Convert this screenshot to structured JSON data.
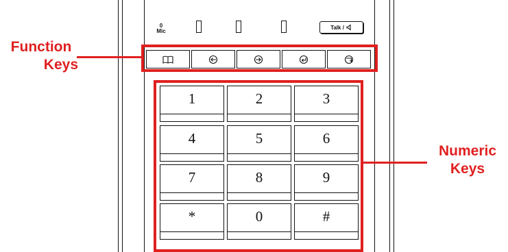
{
  "device": {
    "mic_label_top": "0",
    "mic_label_bottom": "Mic",
    "talk_button_label": "Talk /",
    "function_keys": [
      {
        "icon": "phonebook-icon"
      },
      {
        "icon": "arrow-left-icon"
      },
      {
        "icon": "arrow-right-icon"
      },
      {
        "icon": "enter-icon"
      },
      {
        "icon": "hangup-icon"
      }
    ],
    "numeric_keys": [
      [
        "1",
        "2",
        "3"
      ],
      [
        "4",
        "5",
        "6"
      ],
      [
        "7",
        "8",
        "9"
      ],
      [
        "*",
        "0",
        "#"
      ]
    ]
  },
  "annotations": {
    "function_keys_label_line1": "Function",
    "function_keys_label_line2": "Keys",
    "numeric_keys_label_line1": "Numeric",
    "numeric_keys_label_line2": "Keys",
    "highlight_color": "#e02020"
  }
}
